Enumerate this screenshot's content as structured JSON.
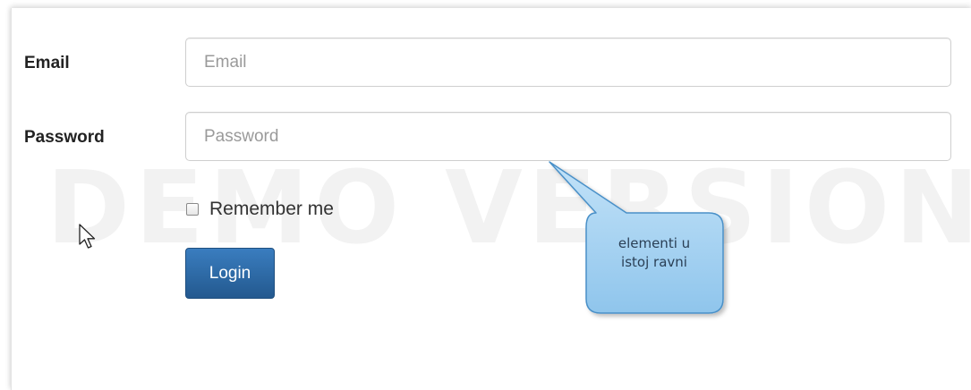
{
  "watermark": "DEMO VERSION",
  "form": {
    "email_label": "Email",
    "email_placeholder": "Email",
    "password_label": "Password",
    "password_placeholder": "Password",
    "remember_label": "Remember me",
    "remember_checked": false,
    "login_label": "Login"
  },
  "callout": {
    "line1": "elementi u",
    "line2": "istoj ravni"
  },
  "colors": {
    "button": "#2a6496",
    "callout_fill": "#a6d3f2",
    "callout_border": "#4a90c8"
  },
  "icons": {
    "cursor": "arrow-pointer"
  }
}
